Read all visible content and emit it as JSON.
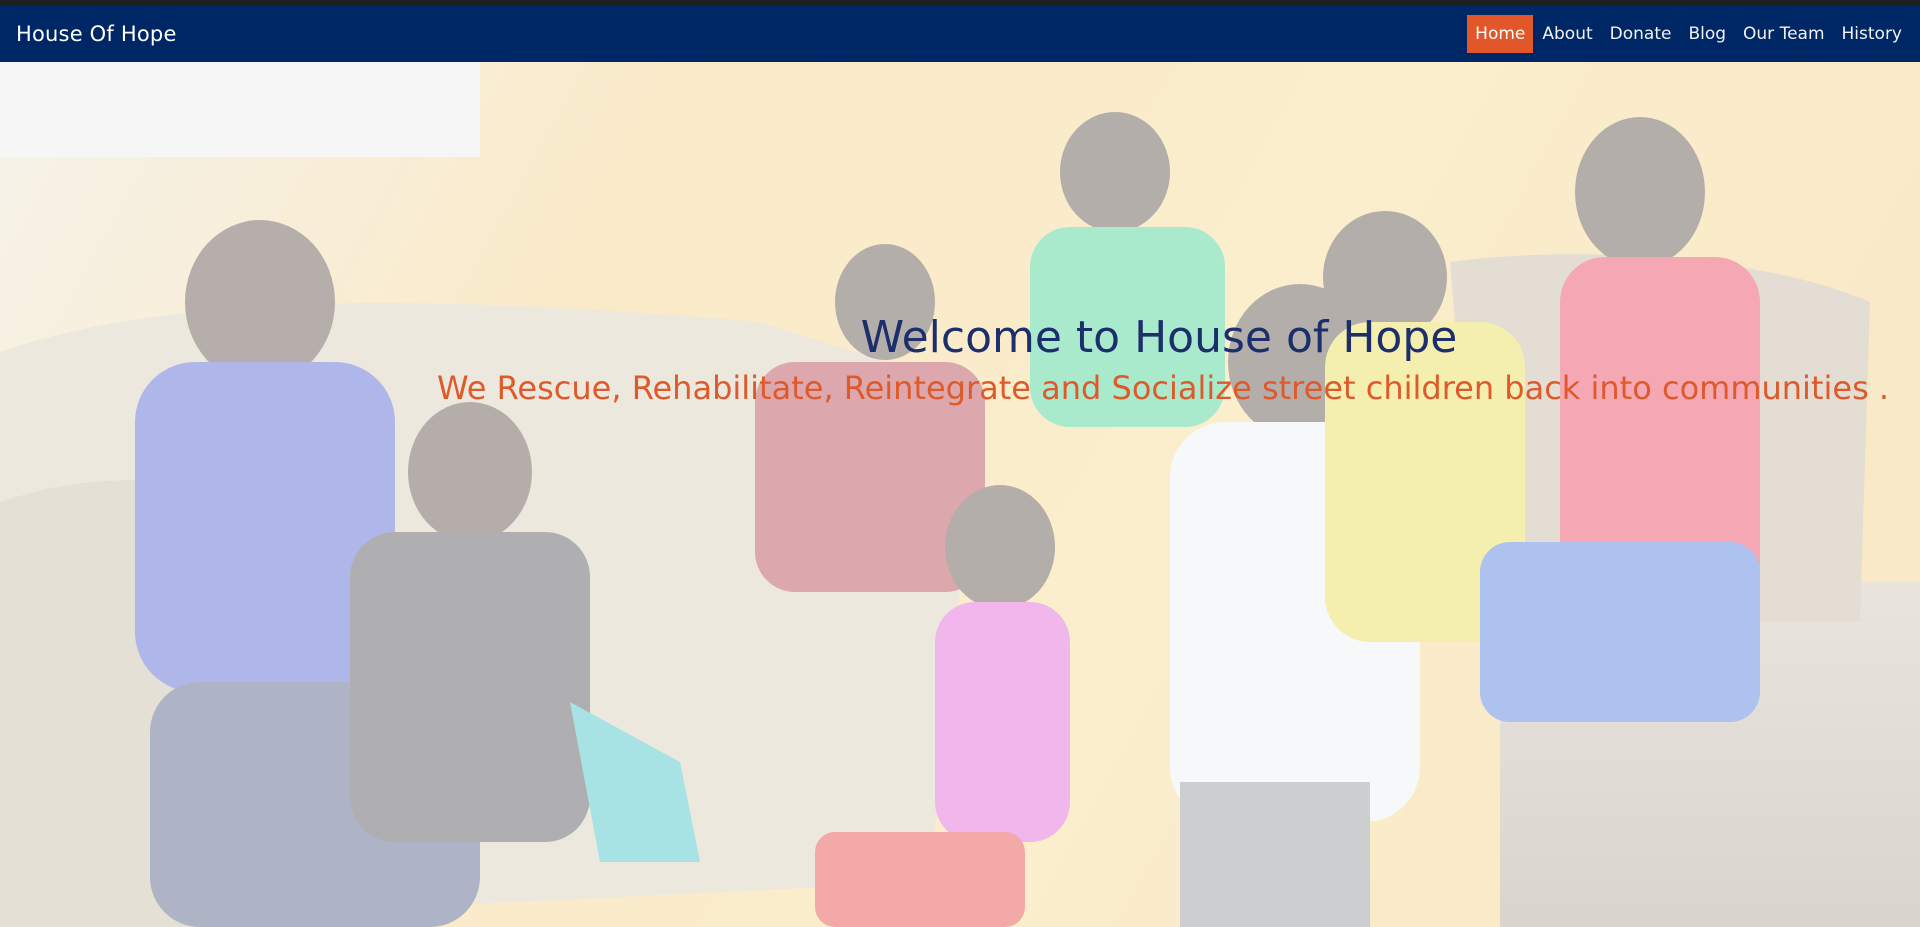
{
  "brand": {
    "name": "House Of Hope"
  },
  "nav": {
    "items": [
      {
        "label": "Home",
        "active": true
      },
      {
        "label": "About",
        "active": false
      },
      {
        "label": "Donate",
        "active": false
      },
      {
        "label": "Blog",
        "active": false
      },
      {
        "label": "Our Team",
        "active": false
      },
      {
        "label": "History",
        "active": false
      }
    ]
  },
  "hero": {
    "title": "Welcome to House of Hope",
    "subtitle": "We Rescue, Rehabilitate, Reintegrate and Socialize street children back into communities .",
    "background_image": "children-group-photo"
  },
  "colors": {
    "navbar": "#002765",
    "active_nav": "#e2572a",
    "title": "#1d2f6b",
    "subtitle": "#de5a2b"
  }
}
